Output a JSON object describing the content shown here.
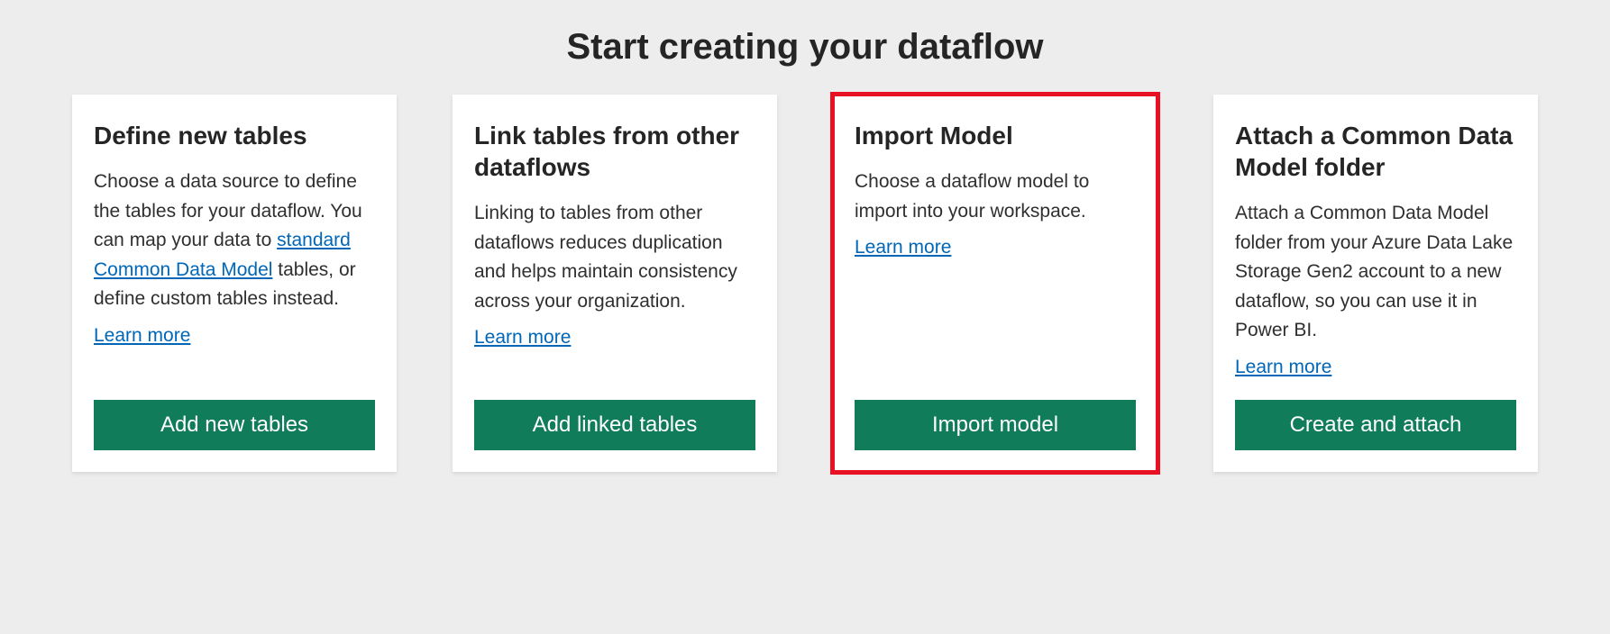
{
  "page": {
    "title": "Start creating your dataflow"
  },
  "cards": [
    {
      "title": "Define new tables",
      "description_pre": "Choose a data source to define the tables for your dataflow. You can map your data to ",
      "description_link": "standard Common Data Model",
      "description_post": " tables, or define custom tables instead.",
      "learn_more": "Learn more",
      "button": "Add new tables"
    },
    {
      "title": "Link tables from other dataflows",
      "description": "Linking to tables from other dataflows reduces duplication and helps maintain consistency across your organization.",
      "learn_more": "Learn more",
      "button": "Add linked tables"
    },
    {
      "title": "Import Model",
      "description": "Choose a dataflow model to import into your workspace.",
      "learn_more": "Learn more",
      "button": "Import model"
    },
    {
      "title": "Attach a Common Data Model folder",
      "description": "Attach a Common Data Model folder from your Azure Data Lake Storage Gen2 account to a new dataflow, so you can use it in Power BI.",
      "learn_more": "Learn more",
      "button": "Create and attach"
    }
  ]
}
